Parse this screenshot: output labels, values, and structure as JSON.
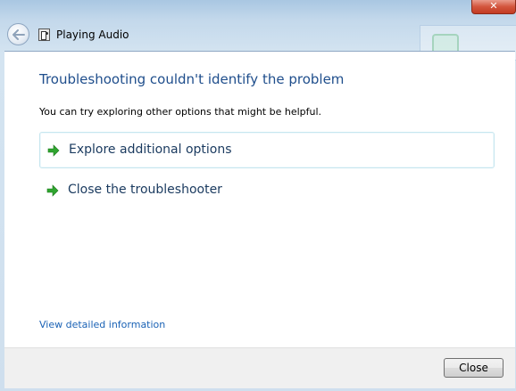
{
  "window": {
    "title": "Playing Audio",
    "close_glyph": "✕"
  },
  "icons": {
    "back": "back-arrow-icon",
    "app": "troubleshooter-icon",
    "option_arrow": "green-arrow-icon"
  },
  "main": {
    "heading": "Troubleshooting couldn't identify the problem",
    "subtext": "You can try exploring other options that might be helpful.",
    "options": [
      {
        "label": "Explore additional options"
      },
      {
        "label": "Close the troubleshooter"
      }
    ],
    "details_link": "View detailed information"
  },
  "footer": {
    "close_label": "Close"
  },
  "colors": {
    "heading": "#1f4e8c",
    "link": "#1a62b5",
    "arrow": "#2fa52f"
  }
}
